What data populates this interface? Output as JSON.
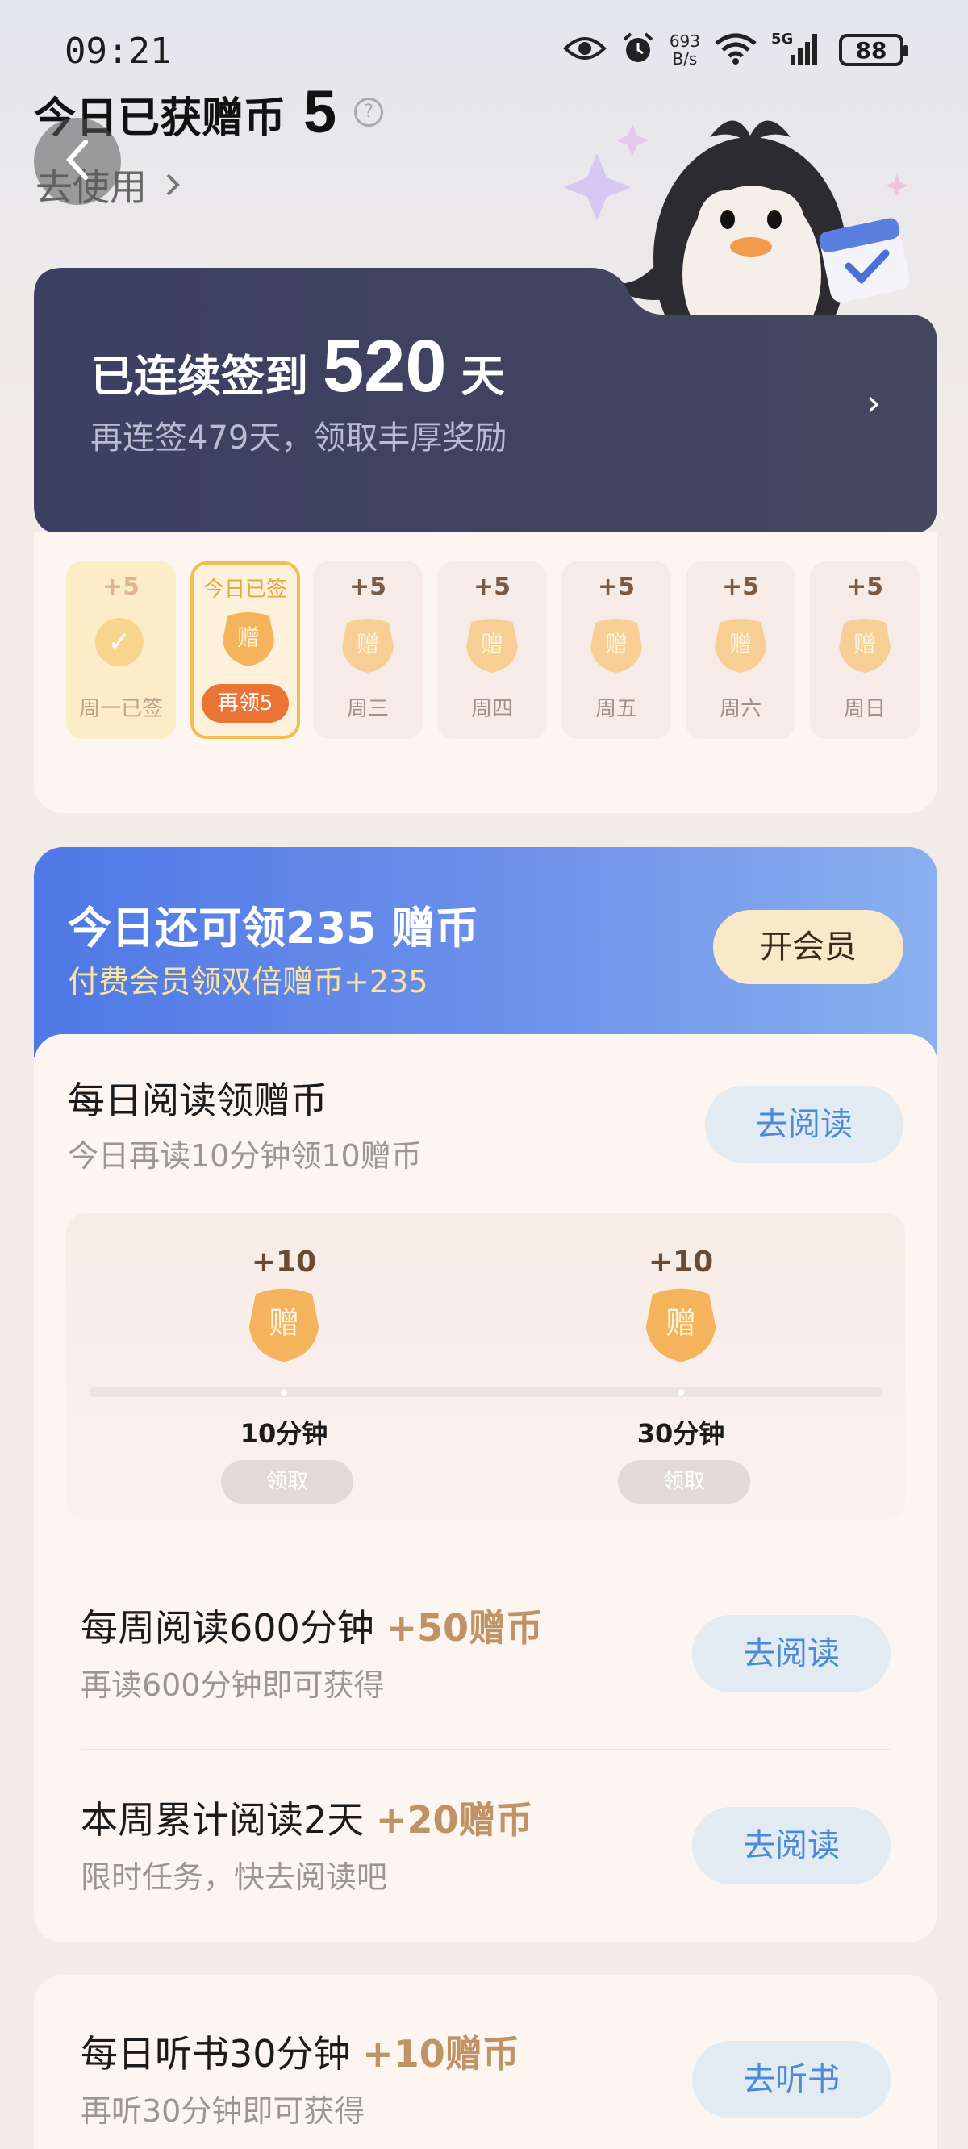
{
  "status_bar": {
    "time": "09:21",
    "net_speed_value": "693",
    "net_speed_unit": "B/s",
    "network": "5G",
    "battery": "88"
  },
  "header": {
    "title": "今日已获赠币",
    "coins": "5",
    "use_link": "去使用"
  },
  "streak": {
    "prefix": "已连续签到",
    "days": "520",
    "suffix": "天",
    "subtitle": "再连签479天，领取丰厚奖励"
  },
  "week": [
    {
      "plus": "+5",
      "name": "周一已签",
      "state": "done"
    },
    {
      "plus": "今日已签",
      "name": "再领5",
      "state": "today"
    },
    {
      "plus": "+5",
      "name": "周三",
      "state": "future"
    },
    {
      "plus": "+5",
      "name": "周四",
      "state": "future"
    },
    {
      "plus": "+5",
      "name": "周五",
      "state": "future"
    },
    {
      "plus": "+5",
      "name": "周六",
      "state": "future"
    },
    {
      "plus": "+5",
      "name": "周日",
      "state": "future"
    }
  ],
  "coin_glyph": "赠",
  "promo": {
    "title": "今日还可领235 赠币",
    "subtitle": "付费会员领双倍赠币+235",
    "button": "开会员"
  },
  "daily_read": {
    "title": "每日阅读领赠币",
    "subtitle": "今日再读10分钟领10赠币",
    "button": "去阅读",
    "milestones": [
      {
        "plus": "+10",
        "label": "10分钟",
        "button": "领取"
      },
      {
        "plus": "+10",
        "label": "30分钟",
        "button": "领取"
      }
    ]
  },
  "weekly_read": {
    "title": "每周阅读600分钟",
    "reward": "+50赠币",
    "subtitle": "再读600分钟即可获得",
    "button": "去阅读"
  },
  "weekly_days": {
    "title": "本周累计阅读2天",
    "reward": "+20赠币",
    "subtitle": "限时任务，快去阅读吧",
    "button": "去阅读"
  },
  "listen": {
    "title": "每日听书30分钟",
    "reward": "+10赠币",
    "subtitle": "再听30分钟即可获得",
    "button": "去听书"
  },
  "colors": {
    "streak_bg": "#3a3e5f",
    "promo_start": "#4f78e6",
    "reward_gold": "#c09366",
    "go_button_text": "#4a8bd7",
    "again_button": "#ea7436"
  }
}
